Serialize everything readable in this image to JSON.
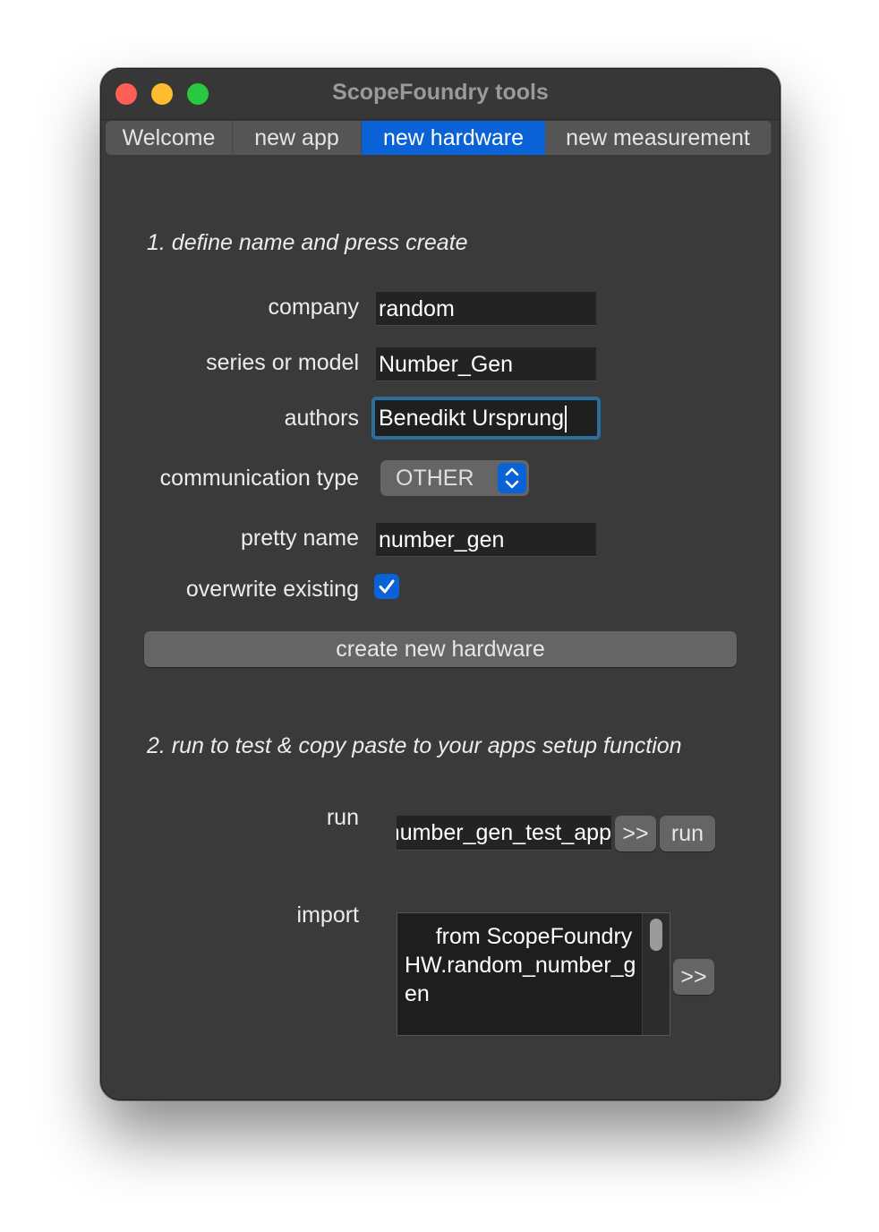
{
  "window": {
    "title": "ScopeFoundry tools"
  },
  "tabs": [
    {
      "label": "Welcome",
      "active": false
    },
    {
      "label": "new app",
      "active": false
    },
    {
      "label": "new hardware",
      "active": true
    },
    {
      "label": "new measurement",
      "active": false
    }
  ],
  "section1": {
    "title": "1. define name and press create",
    "company": {
      "label": "company",
      "value": "random"
    },
    "series": {
      "label": "series or model",
      "value": "Number_Gen"
    },
    "authors": {
      "label": "authors",
      "value": "Benedikt Ursprung"
    },
    "communication": {
      "label": "communication type",
      "value": "OTHER"
    },
    "pretty_name": {
      "label": "pretty name",
      "value": "number_gen"
    },
    "overwrite": {
      "label": "overwrite existing",
      "checked": true
    },
    "create_button": "create new hardware"
  },
  "section2": {
    "title": "2. run to test & copy paste to your apps setup function",
    "run": {
      "label": "run",
      "value": "number_gen_test_app",
      "copy_button": ">>",
      "run_button": "run"
    },
    "import": {
      "label": "import",
      "text": "     from ScopeFoundryHW.random_number_gen",
      "copy_button": ">>"
    }
  },
  "colors": {
    "accent": "#0a63d6",
    "window_bg": "#3a3a3a",
    "close": "#ff5f57",
    "minimize": "#febc2e",
    "zoom": "#28c840"
  }
}
